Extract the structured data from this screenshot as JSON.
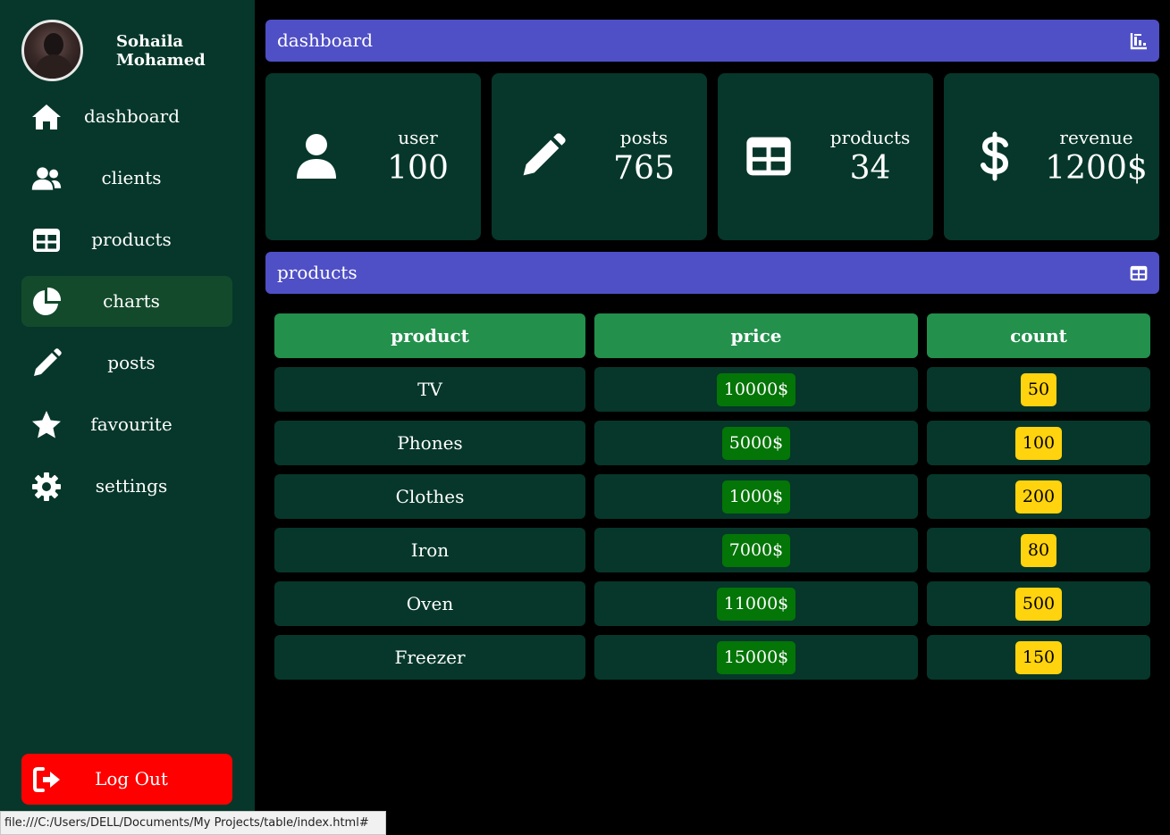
{
  "user": {
    "name": "Sohaila Mohamed"
  },
  "nav": {
    "items": [
      {
        "label": "dashboard",
        "icon": "home-icon"
      },
      {
        "label": "clients",
        "icon": "users-icon"
      },
      {
        "label": "products",
        "icon": "table-icon"
      },
      {
        "label": "charts",
        "icon": "pie-chart-icon",
        "active": true
      },
      {
        "label": "posts",
        "icon": "pencil-icon"
      },
      {
        "label": "favourite",
        "icon": "star-icon"
      },
      {
        "label": "settings",
        "icon": "gear-icon"
      }
    ],
    "logout_label": "Log Out"
  },
  "header": {
    "title": "dashboard",
    "icon": "chart-bar-icon"
  },
  "cards": [
    {
      "title": "user",
      "value": "100",
      "icon": "user-icon"
    },
    {
      "title": "posts",
      "value": "765",
      "icon": "pencil-icon"
    },
    {
      "title": "products",
      "value": "34",
      "icon": "table-icon"
    },
    {
      "title": "revenue",
      "value": "1200$",
      "icon": "dollar-icon"
    }
  ],
  "products_section": {
    "title": "products",
    "icon": "table-icon"
  },
  "table": {
    "headers": [
      "product",
      "price",
      "count"
    ],
    "rows": [
      {
        "product": "TV",
        "price": "10000$",
        "count": "50"
      },
      {
        "product": "Phones",
        "price": "5000$",
        "count": "100"
      },
      {
        "product": "Clothes",
        "price": "1000$",
        "count": "200"
      },
      {
        "product": "Iron",
        "price": "7000$",
        "count": "80"
      },
      {
        "product": "Oven",
        "price": "11000$",
        "count": "500"
      },
      {
        "product": "Freezer",
        "price": "15000$",
        "count": "150"
      }
    ]
  },
  "statusbar": {
    "url": "file:///C:/Users/DELL/Documents/My Projects/table/index.html#"
  },
  "colors": {
    "sidebar": "#06372a",
    "header": "#4f4fc6",
    "table_head": "#23904c",
    "price_badge": "#047507",
    "count_badge": "#ffd30d",
    "logout": "#ff0000"
  }
}
